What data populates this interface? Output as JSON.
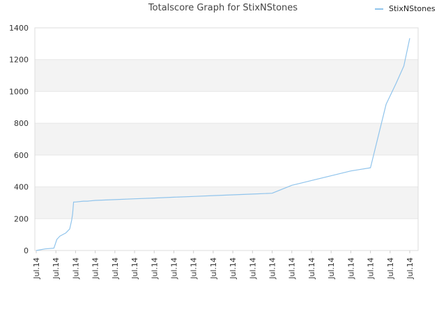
{
  "chart_data": {
    "type": "line",
    "title": "Totalscore Graph for StixNStones",
    "xlabel": "",
    "ylabel": "",
    "ylim": [
      0,
      1400
    ],
    "yticks": [
      0,
      200,
      400,
      600,
      800,
      1000,
      1200,
      1400
    ],
    "x_tick_labels": [
      "Jul.14",
      "Jul.14",
      "Jul.14",
      "Jul.14",
      "Jul.14",
      "Jul.14",
      "Jul.14",
      "Jul.14",
      "Jul.14",
      "Jul.14",
      "Jul.14",
      "Jul.14",
      "Jul.14",
      "Jul.14",
      "Jul.14",
      "Jul.14",
      "Jul.14",
      "Jul.14",
      "Jul.14",
      "Jul.14"
    ],
    "legend_position": "top-right",
    "grid": true,
    "series": [
      {
        "name": "StixNStones",
        "color": "#90c4ec",
        "x": [
          0.0,
          0.45,
          0.9,
          1.05,
          1.2,
          1.5,
          1.7,
          1.8,
          1.85,
          1.9,
          2.0,
          2.4,
          2.6,
          3.0,
          4.0,
          5.0,
          6.0,
          7.0,
          8.0,
          9.0,
          10.0,
          11.0,
          12.0,
          13.0,
          13.5,
          14.0,
          15.0,
          16.0,
          17.0,
          17.8,
          18.3,
          18.7,
          19.0
        ],
        "values": [
          0,
          10,
          15,
          70,
          90,
          110,
          135,
          190,
          230,
          305,
          305,
          310,
          310,
          315,
          320,
          325,
          330,
          335,
          340,
          345,
          350,
          355,
          360,
          410,
          425,
          440,
          470,
          500,
          520,
          920,
          1050,
          1160,
          1335
        ]
      }
    ]
  }
}
